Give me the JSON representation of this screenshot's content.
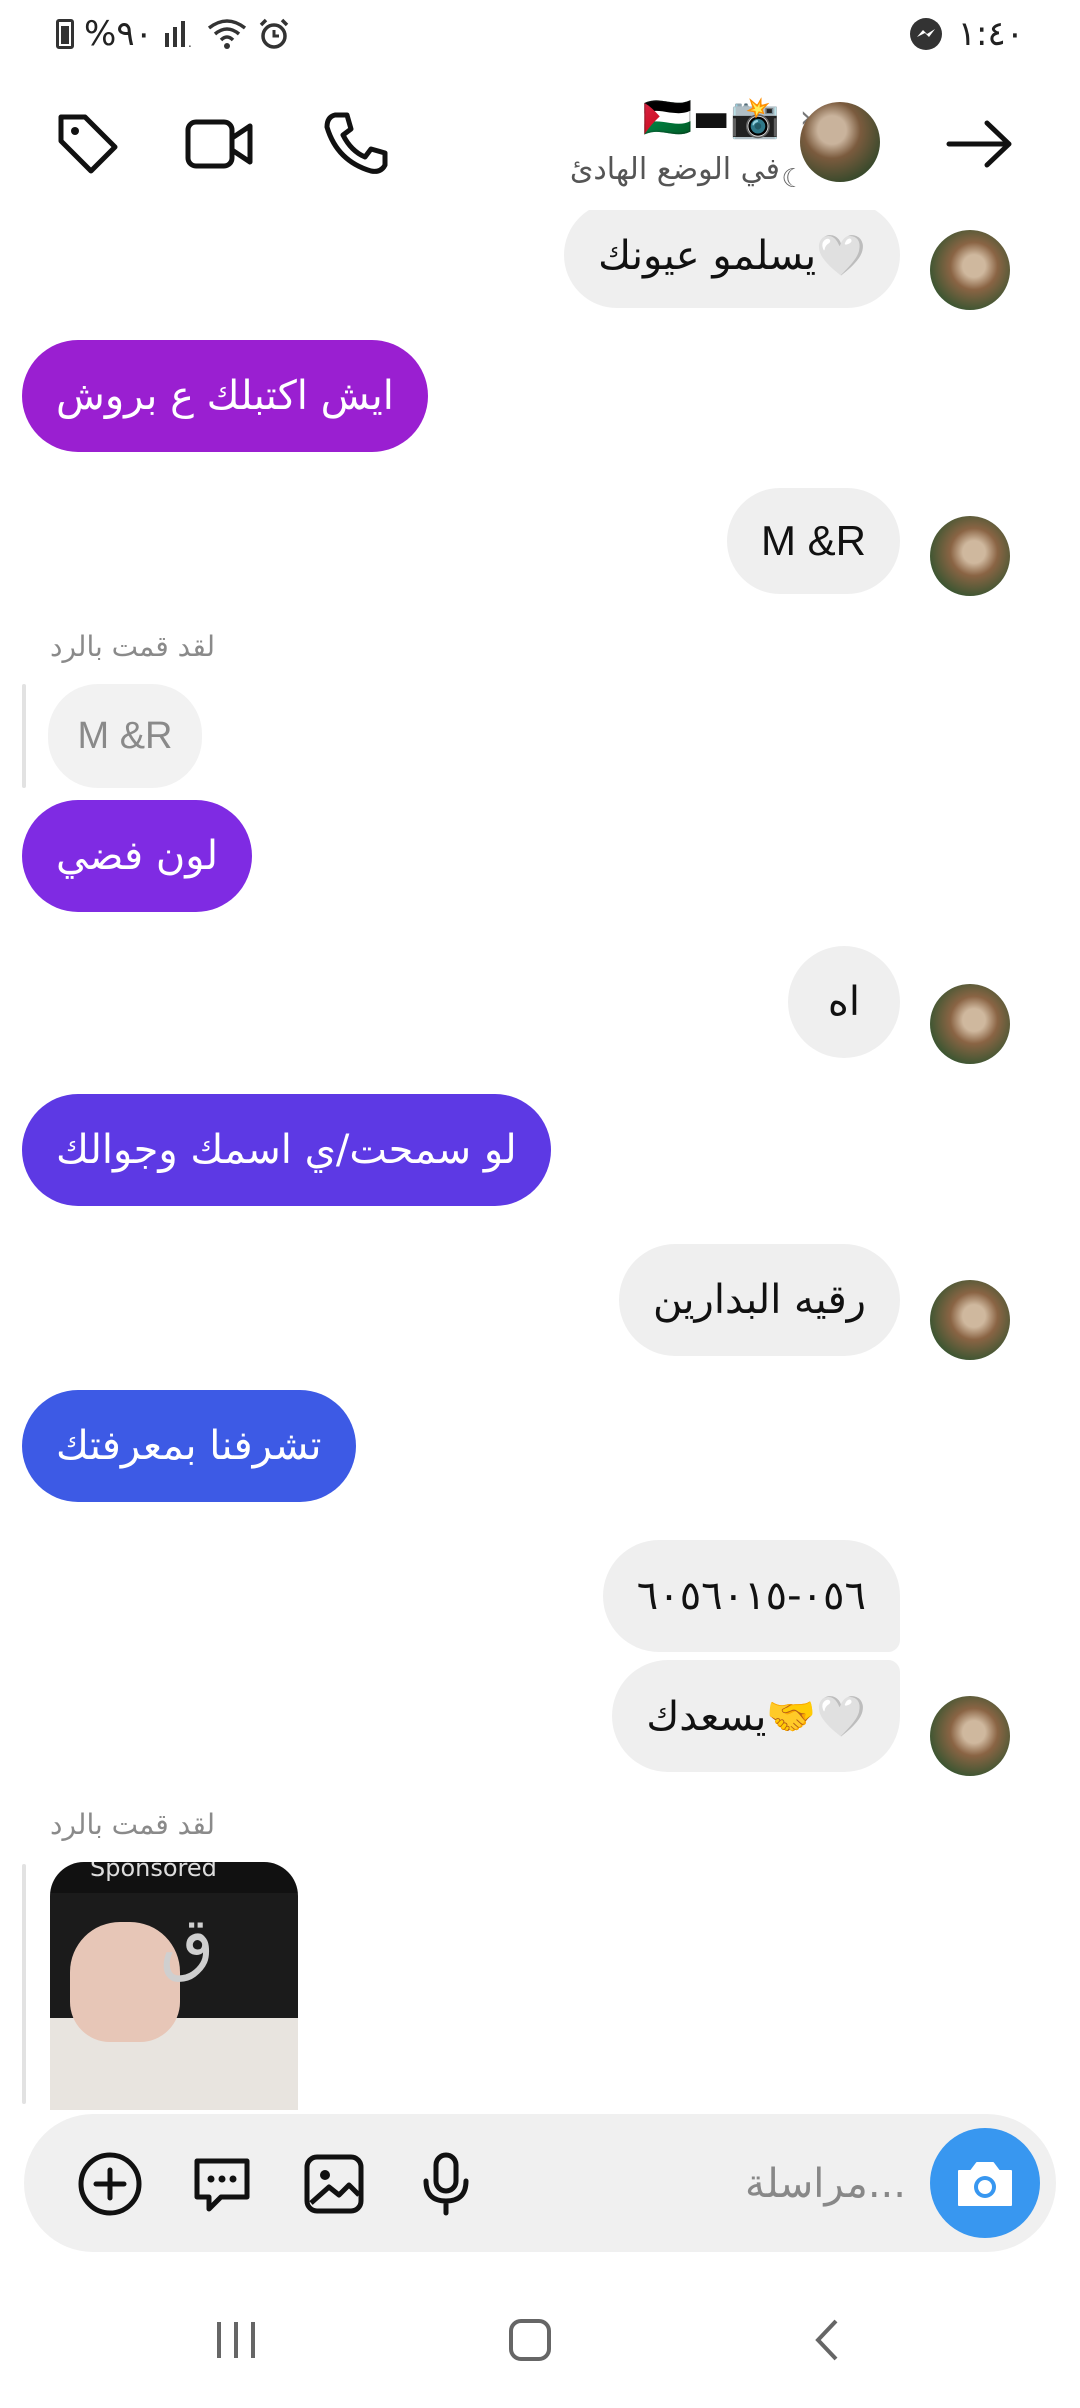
{
  "status_bar": {
    "battery": "%٩٠",
    "time": "١:٤٠"
  },
  "header": {
    "name": "🇵🇸▬📸",
    "subtitle": "في الوضع الهادئ",
    "icons": [
      "arrow-right-icon",
      "tag-icon",
      "video-call-icon",
      "phone-icon"
    ]
  },
  "messages": [
    {
      "side": "in",
      "text": "يسلمو عيونك🤍"
    },
    {
      "side": "out",
      "text": "ايش اكتبلك ع بروش",
      "color": "#9a1fd1"
    },
    {
      "side": "in",
      "text": "M &R"
    },
    {
      "side": "out",
      "reply_label": "لقد قمت بالرد",
      "quoted": "M &R",
      "text": "لون فضي",
      "color": "#7f2be3"
    },
    {
      "side": "in",
      "text": "اه"
    },
    {
      "side": "out",
      "text": "لو سمحت/ي اسمك وجوالك",
      "color": "#5d39e4"
    },
    {
      "side": "in",
      "text": "رقيه البدارين"
    },
    {
      "side": "out",
      "text": "تشرفنا بمعرفتك",
      "color": "#3d5ae5"
    },
    {
      "side": "in",
      "text": "٠٥٦-٦٠٥٦٠١٥"
    },
    {
      "side": "in",
      "text": "يسعدك🤝🤍"
    },
    {
      "side": "out",
      "reply_label": "لقد قمت بالرد",
      "quoted_media": "Sponsored"
    }
  ],
  "composer": {
    "placeholder": "مراسلة..."
  }
}
